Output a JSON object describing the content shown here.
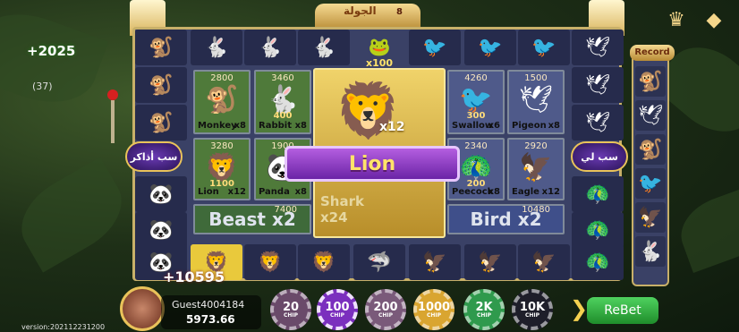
{
  "top": {
    "round_label": "ﺍﻟﺠﻮﻟﺔ",
    "counter": "8",
    "jackpot_mult": "x100"
  },
  "left": {
    "win_amount": "+2025",
    "win_count": "(37)",
    "side_button": "ﺳﺐ ﺃﺫﺍﻛﺮ"
  },
  "right": {
    "side_button": "ﺳﺐ ﻟﻲ",
    "record_title": "Record"
  },
  "bets": [
    {
      "name": "Monkey",
      "mult": "x8",
      "total": "2800",
      "stake": "",
      "icon": "🐒"
    },
    {
      "name": "Rabbit",
      "mult": "x8",
      "total": "3460",
      "stake": "400",
      "icon": "🐇"
    },
    {
      "name": "Swallow",
      "mult": "x6",
      "total": "4260",
      "stake": "300",
      "icon": "🐦"
    },
    {
      "name": "Pigeon",
      "mult": "x8",
      "total": "1500",
      "stake": "",
      "icon": "🕊"
    },
    {
      "name": "Lion",
      "mult": "x12",
      "total": "3280",
      "stake": "1100",
      "icon": "🦁"
    },
    {
      "name": "Panda",
      "mult": "x8",
      "total": "1900",
      "stake": "",
      "icon": "🐼"
    },
    {
      "name": "Peecock",
      "mult": "x8",
      "total": "2340",
      "stake": "200",
      "icon": "🦚"
    },
    {
      "name": "Eagle",
      "mult": "x12",
      "total": "2920",
      "stake": "",
      "icon": "🦅"
    }
  ],
  "groups": {
    "beast": {
      "label": "Beast",
      "mult": "x2",
      "total": "7400"
    },
    "bird": {
      "label": "Bird",
      "mult": "x2",
      "total": "10480"
    },
    "shark": {
      "label": "Shark",
      "mult": "x24"
    }
  },
  "center": {
    "mult": "x12",
    "result": "Lion"
  },
  "bonus_win": "+10595",
  "player": {
    "name": "Guest4004184",
    "balance": "5973.66"
  },
  "chips": [
    {
      "value": "20",
      "label": "CHIP",
      "color": "#6a4a6a"
    },
    {
      "value": "100",
      "label": "CHIP",
      "color": "#7b2fbe"
    },
    {
      "value": "200",
      "label": "CHIP",
      "color": "#7a5a7a"
    },
    {
      "value": "1000",
      "label": "CHIP",
      "color": "#d9a530"
    },
    {
      "value": "2K",
      "label": "CHIP",
      "color": "#2f9a4d"
    },
    {
      "value": "10K",
      "label": "CHIP",
      "color": "#1e1e2a"
    }
  ],
  "rebet_label": "ReBet",
  "version": "version:202112231200"
}
